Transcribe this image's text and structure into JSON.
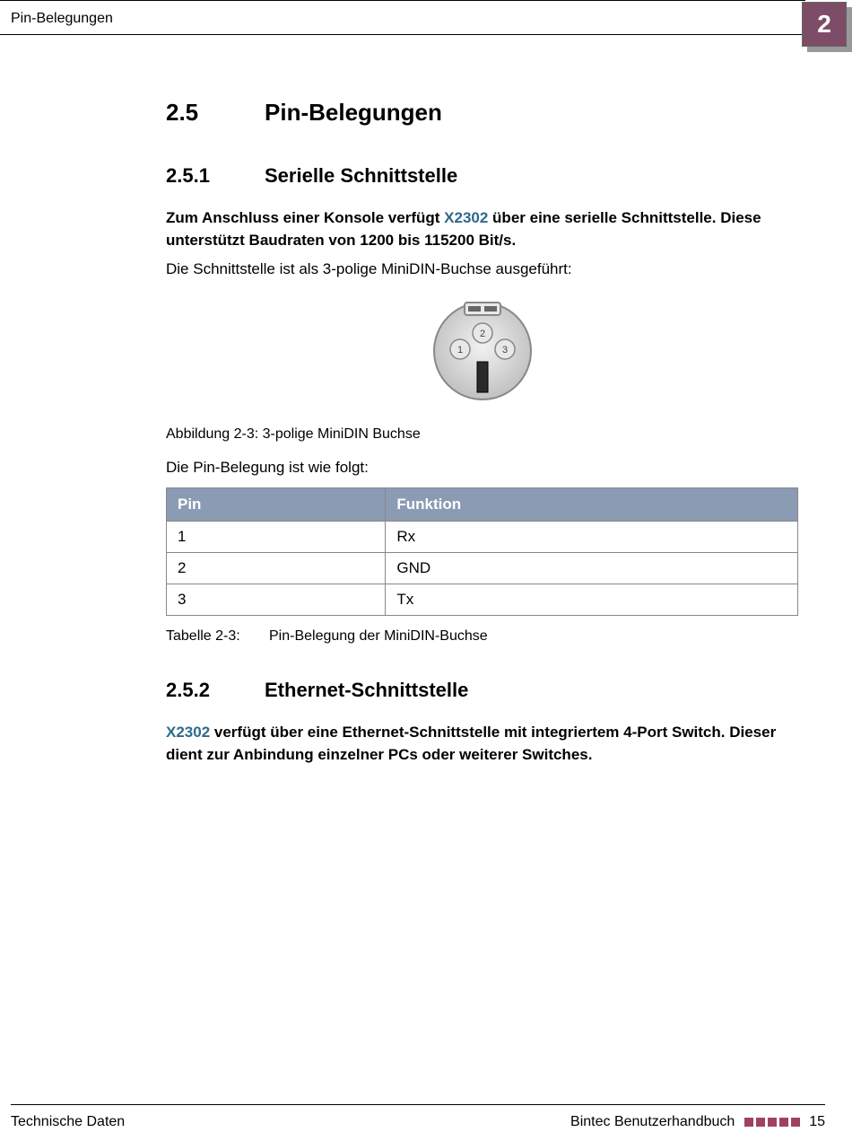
{
  "header": {
    "title": "Pin-Belegungen",
    "chapter": "2"
  },
  "section": {
    "number": "2.5",
    "title": "Pin-Belegungen"
  },
  "sub1": {
    "number": "2.5.1",
    "title": "Serielle Schnittstelle",
    "intro_pre": "Zum Anschluss einer Konsole verfügt ",
    "product": "X2302",
    "intro_post": " über eine serielle Schnittstelle. Diese unterstützt Baudraten von 1200 bis 115200 Bit/s.",
    "line2": "Die Schnittstelle ist als 3-polige MiniDIN-Buchse ausgeführt:",
    "fig_caption": "Abbildung 2-3: 3-polige MiniDIN Buchse",
    "table_intro": "Die Pin-Belegung ist wie folgt:",
    "table": {
      "headers": [
        "Pin",
        "Funktion"
      ],
      "rows": [
        {
          "pin": "1",
          "func": "Rx"
        },
        {
          "pin": "2",
          "func": "GND"
        },
        {
          "pin": "3",
          "func": "Tx"
        }
      ]
    },
    "tab_caption_label": "Tabelle 2-3:",
    "tab_caption_text": "Pin-Belegung der MiniDIN-Buchse"
  },
  "sub2": {
    "number": "2.5.2",
    "title": "Ethernet-Schnittstelle",
    "product": "X2302",
    "text_post": " verfügt über eine Ethernet-Schnittstelle mit integriertem 4-Port Switch. Dieser dient zur Anbindung einzelner PCs oder weiterer Switches."
  },
  "footer": {
    "left": "Technische Daten",
    "center": "Bintec Benutzerhandbuch",
    "page": "15"
  },
  "din_labels": {
    "p1": "1",
    "p2": "2",
    "p3": "3"
  }
}
